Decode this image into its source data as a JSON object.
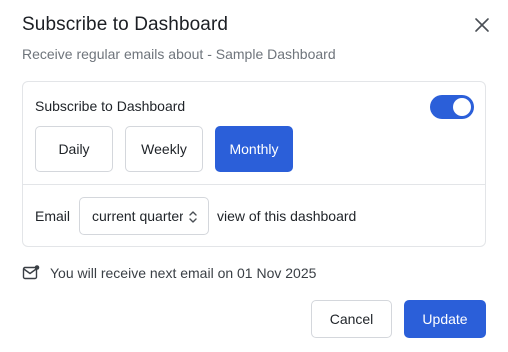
{
  "dialog": {
    "title": "Subscribe to Dashboard",
    "subtitle": "Receive regular emails about - Sample Dashboard",
    "close_icon": "close-icon"
  },
  "subscription": {
    "label": "Subscribe to Dashboard",
    "toggle_on": true,
    "frequencies": [
      {
        "label": "Daily",
        "selected": false
      },
      {
        "label": "Weekly",
        "selected": false
      },
      {
        "label": "Monthly",
        "selected": true
      }
    ],
    "email_label": "Email",
    "period_value": "current quarter",
    "view_text": "view of this dashboard"
  },
  "notice": {
    "icon": "mail-icon",
    "text": "You will receive next email on 01 Nov 2025"
  },
  "actions": {
    "cancel_label": "Cancel",
    "update_label": "Update"
  },
  "colors": {
    "primary": "#2b5fd9",
    "border": "#e3e5e8",
    "muted_text": "#6f757c"
  }
}
